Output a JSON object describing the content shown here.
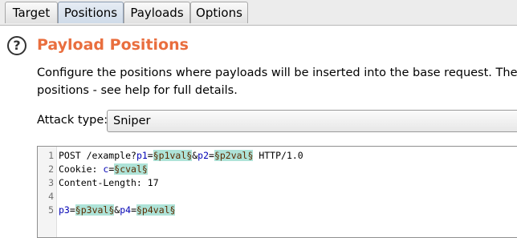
{
  "tabs": [
    {
      "label": "Target",
      "active": false
    },
    {
      "label": "Positions",
      "active": true
    },
    {
      "label": "Payloads",
      "active": false
    },
    {
      "label": "Options",
      "active": false
    }
  ],
  "help_icon": {
    "glyph": "?",
    "icon": "help-icon"
  },
  "title": "Payload Positions",
  "description": {
    "line1": "Configure the positions where payloads will be inserted into the base request. The attac",
    "line2": "positions - see help for full details."
  },
  "attack_type": {
    "label": "Attack type:",
    "value": "Sniper"
  },
  "colors": {
    "title": "#e96e3e",
    "marker_background": "#aee3d8",
    "param_name": "#0000b4",
    "header_value": "#b40000"
  },
  "request": {
    "lines": [
      {
        "number": "1",
        "segments": [
          {
            "text": "POST /example?",
            "type": "plain"
          },
          {
            "text": "p1",
            "type": "param"
          },
          {
            "text": "=",
            "type": "plain"
          },
          {
            "text": "§p1val§",
            "type": "marker"
          },
          {
            "text": "&",
            "type": "plain"
          },
          {
            "text": "p2",
            "type": "param"
          },
          {
            "text": "=",
            "type": "plain"
          },
          {
            "text": "§p2val§",
            "type": "marker"
          },
          {
            "text": " HTTP/1.0",
            "type": "plain"
          }
        ]
      },
      {
        "number": "2",
        "segments": [
          {
            "text": "Cookie: ",
            "type": "plain"
          },
          {
            "text": "c",
            "type": "param"
          },
          {
            "text": "=",
            "type": "plain"
          },
          {
            "text": "§cval§",
            "type": "marker"
          }
        ]
      },
      {
        "number": "3",
        "segments": [
          {
            "text": "Content-Length: ",
            "type": "plain"
          },
          {
            "text": "17",
            "type": "plain"
          }
        ]
      },
      {
        "number": "4",
        "segments": []
      },
      {
        "number": "5",
        "segments": [
          {
            "text": "p3",
            "type": "param"
          },
          {
            "text": "=",
            "type": "plain"
          },
          {
            "text": "§p3val§",
            "type": "marker"
          },
          {
            "text": "&",
            "type": "plain"
          },
          {
            "text": "p4",
            "type": "param"
          },
          {
            "text": "=",
            "type": "plain"
          },
          {
            "text": "§p4val§",
            "type": "marker"
          }
        ]
      }
    ]
  }
}
